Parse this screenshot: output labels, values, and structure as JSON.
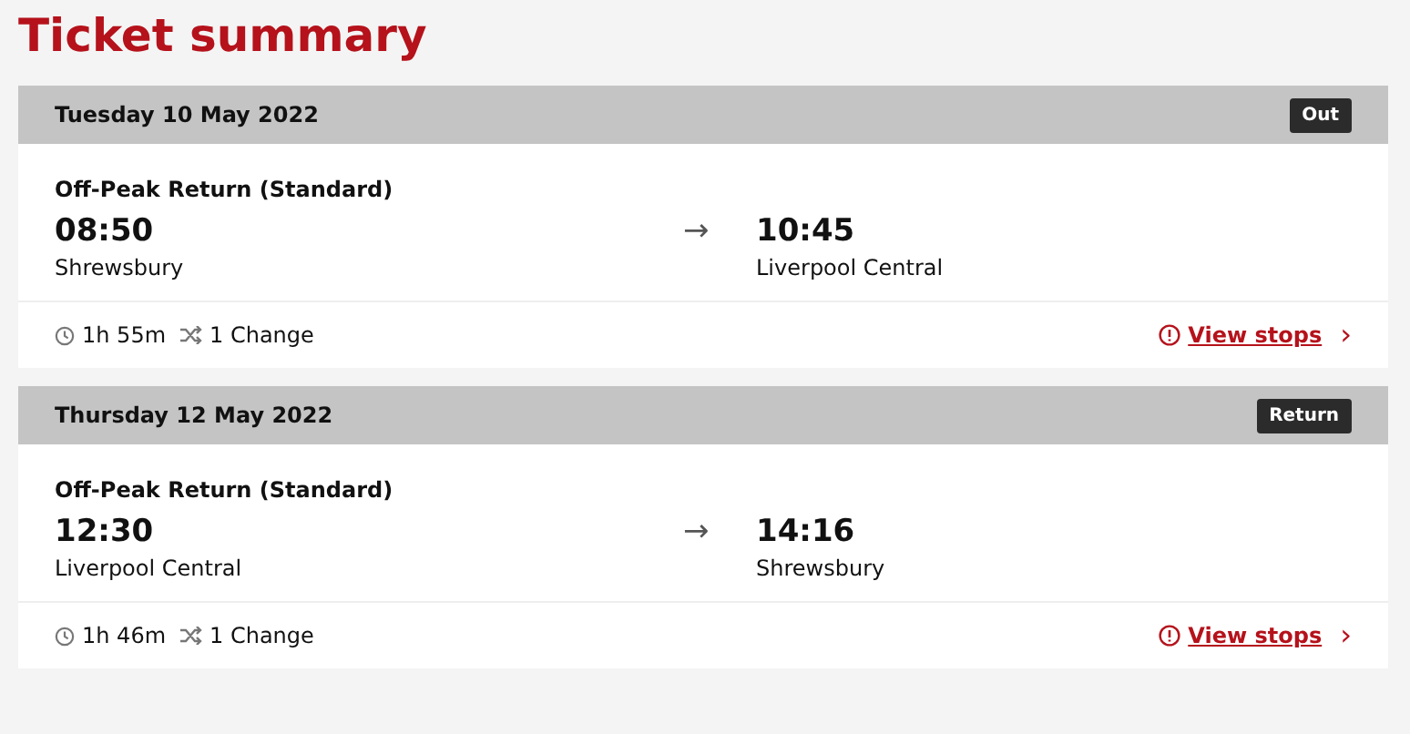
{
  "title": "Ticket summary",
  "journeys": [
    {
      "date": "Tuesday 10 May 2022",
      "badge": "Out",
      "fare": "Off-Peak Return (Standard)",
      "depart_time": "08:50",
      "depart_station": "Shrewsbury",
      "arrow": "→",
      "arrive_time": "10:45",
      "arrive_station": "Liverpool Central",
      "duration": "1h 55m",
      "changes": "1 Change",
      "link": "View stops",
      "chevron": "›"
    },
    {
      "date": "Thursday 12 May 2022",
      "badge": "Return",
      "fare": "Off-Peak Return (Standard)",
      "depart_time": "12:30",
      "depart_station": "Liverpool Central",
      "arrow": "→",
      "arrive_time": "14:16",
      "arrive_station": "Shrewsbury",
      "duration": "1h 46m",
      "changes": "1 Change",
      "link": "View stops",
      "chevron": "›"
    }
  ]
}
